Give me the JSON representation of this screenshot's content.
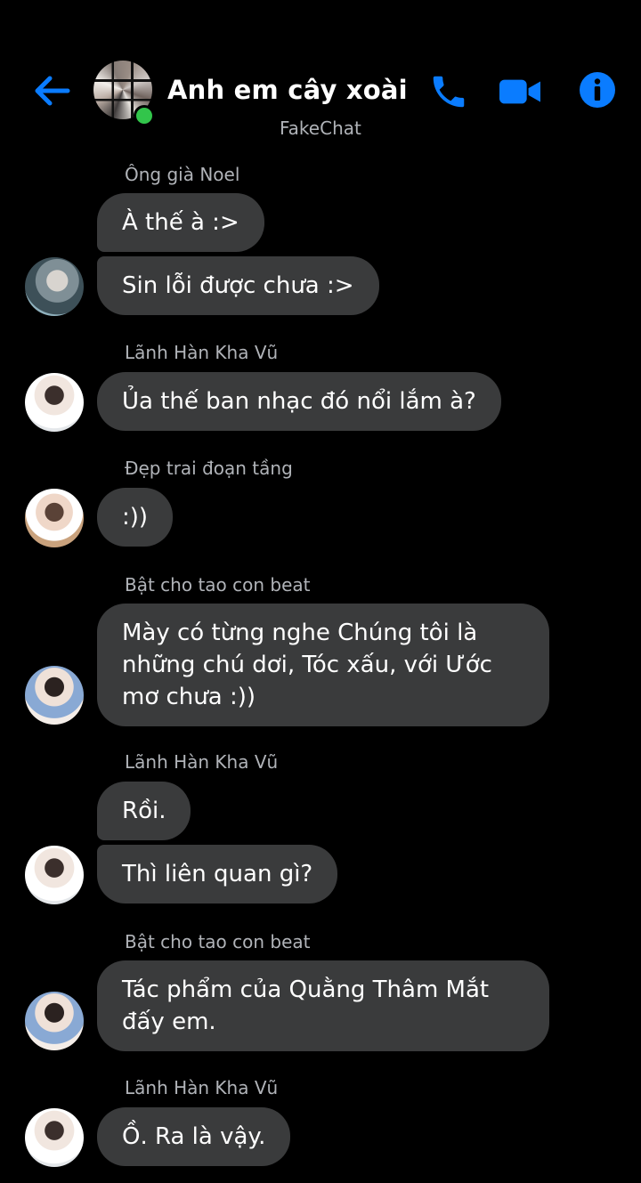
{
  "header": {
    "title": "Anh em cây xoài",
    "subtitle": "FakeChat",
    "back_icon": "back-arrow-icon",
    "call_icon": "phone-icon",
    "video_icon": "video-camera-icon",
    "info_icon": "info-icon",
    "accent_color": "#0a7cff"
  },
  "messages": {
    "g1": {
      "sender": "Ông già Noel",
      "m1": "À thế à :>",
      "m2": "Sin lỗi được chưa :>"
    },
    "g2": {
      "sender": "Lãnh Hàn Kha Vũ",
      "m1": "Ủa thế ban nhạc đó nổi lắm à?"
    },
    "g3": {
      "sender": "Đẹp trai đoạn tầng",
      "m1": ":))"
    },
    "g4": {
      "sender": "Bật cho tao con beat",
      "m1": "Mày có từng nghe Chúng tôi là những chú dơi, Tóc xấu, với Ước mơ chưa :))"
    },
    "g5": {
      "sender": "Lãnh Hàn Kha Vũ",
      "m1": "Rồi.",
      "m2": "Thì liên quan gì?"
    },
    "g6": {
      "sender": "Bật cho tao con beat",
      "m1": "Tác phẩm của Quằng Thâm Mắt đấy em."
    },
    "g7": {
      "sender": "Lãnh Hàn Kha Vũ",
      "m1": "Ồ. Ra là vậy."
    }
  }
}
